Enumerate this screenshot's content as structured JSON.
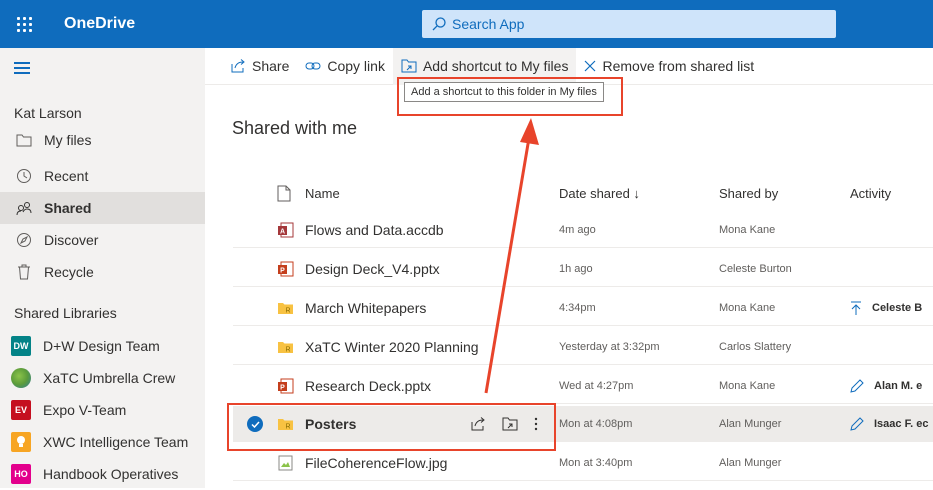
{
  "app": {
    "title": "OneDrive",
    "search_placeholder": "Search App"
  },
  "sidebar": {
    "user": "Kat Larson",
    "items": [
      {
        "label": "My files",
        "icon": "folder-icon"
      },
      {
        "label": "Recent",
        "icon": "clock-icon"
      },
      {
        "label": "Shared",
        "icon": "people-icon",
        "active": true
      },
      {
        "label": "Discover",
        "icon": "compass-icon"
      },
      {
        "label": "Recycle",
        "icon": "recycle-bin-icon"
      }
    ],
    "libraries_heading": "Shared Libraries",
    "libraries": [
      {
        "label": "D+W Design Team",
        "badge": "DW",
        "color": "#038387"
      },
      {
        "label": "XaTC Umbrella Crew",
        "badge": "",
        "color": "#5c9c3a"
      },
      {
        "label": "Expo V-Team",
        "badge": "EV",
        "color": "#c50f1f"
      },
      {
        "label": "XWC Intelligence Team",
        "badge": "",
        "color": "#f7a523"
      },
      {
        "label": "Handbook Operatives",
        "badge": "HO",
        "color": "#e3008c"
      }
    ]
  },
  "commands": {
    "share": "Share",
    "copy_link": "Copy link",
    "add_shortcut": "Add shortcut to My files",
    "remove": "Remove from shared list"
  },
  "tooltip": "Add a shortcut to this folder in My files",
  "page_title": "Shared with me",
  "columns": {
    "name": "Name",
    "date": "Date shared ↓",
    "by": "Shared by",
    "activity": "Activity"
  },
  "files": [
    {
      "name": "Flows and Data.accdb",
      "type": "access",
      "date": "4m ago",
      "by": "Mona Kane",
      "activity": ""
    },
    {
      "name": "Design Deck_V4.pptx",
      "type": "powerpoint",
      "date": "1h ago",
      "by": "Celeste Burton",
      "activity": ""
    },
    {
      "name": "March Whitepapers",
      "type": "shared-folder",
      "date": "4:34pm",
      "by": "Mona Kane",
      "activity": "Celeste B"
    },
    {
      "name": "XaTC Winter 2020 Planning",
      "type": "shared-folder",
      "date": "Yesterday at 3:32pm",
      "by": "Carlos Slattery",
      "activity": ""
    },
    {
      "name": "Research Deck.pptx",
      "type": "powerpoint",
      "date": "Wed at 4:27pm",
      "by": "Mona Kane",
      "activity": "Alan M. e"
    },
    {
      "name": "Posters",
      "type": "shared-folder",
      "date": "Mon at 4:08pm",
      "by": "Alan Munger",
      "activity": "Isaac F. ec",
      "selected": true
    },
    {
      "name": "FileCoherenceFlow.jpg",
      "type": "image",
      "date": "Mon at 3:40pm",
      "by": "Alan Munger",
      "activity": ""
    }
  ],
  "colors": {
    "brand": "#0f6cbd",
    "annotation": "#e8442b"
  }
}
